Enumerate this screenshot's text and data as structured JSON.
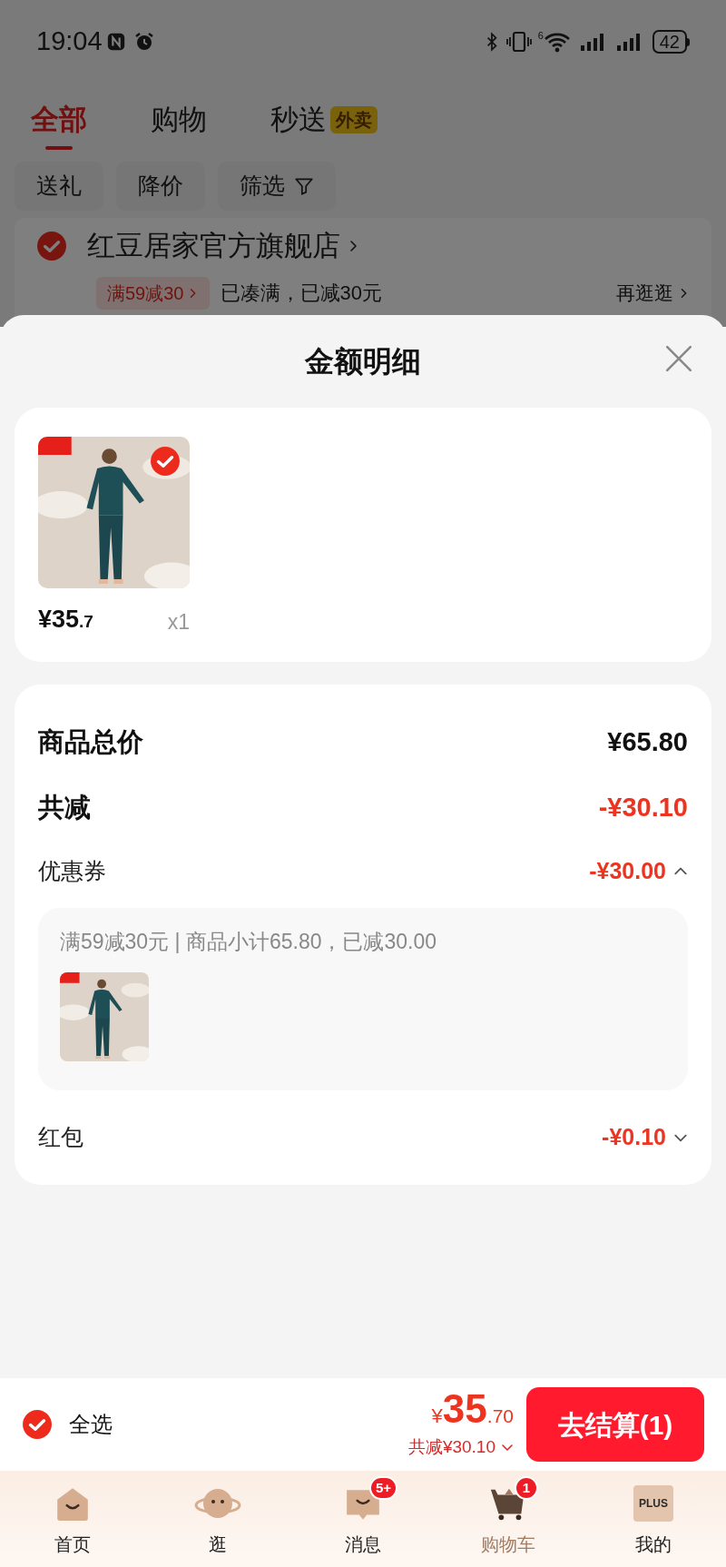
{
  "status_bar": {
    "time": "19:04",
    "wifi_label": "6",
    "battery": "42"
  },
  "tabs": [
    {
      "label": "全部",
      "selected": true
    },
    {
      "label": "购物",
      "selected": false
    },
    {
      "label": "秒送",
      "badge": "外卖",
      "selected": false
    }
  ],
  "filters": [
    {
      "label": "送礼",
      "kind": "plain"
    },
    {
      "label": "降价",
      "kind": "plain"
    },
    {
      "label": "筛选",
      "kind": "filter"
    }
  ],
  "store": {
    "name": "红豆居家官方旗舰店",
    "checked": true,
    "promo_tag": "满59减30",
    "promo_text": "已凑满，已减30元",
    "more_link": "再逛逛"
  },
  "sheet": {
    "title": "金额明细",
    "items": [
      {
        "kind": "picture",
        "price_integer": "¥35",
        "price_decimal": ".7",
        "quantity": "x1",
        "selected": true
      }
    ],
    "rows": [
      {
        "kind": "total",
        "label": "商品总价",
        "value": "¥65.80"
      },
      {
        "kind": "discount",
        "label": "共减",
        "value": "-¥30.10"
      },
      {
        "kind": "expandable",
        "label": "优惠券",
        "value": "-¥30.00",
        "expanded": true,
        "detail": "满59减30元 | 商品小计65.80，已减30.00"
      },
      {
        "kind": "expandable",
        "label": "红包",
        "value": "-¥0.10",
        "expanded": false
      }
    ]
  },
  "footer": {
    "select_all": {
      "label": "全选",
      "checked": true
    },
    "currency": "¥",
    "total_integer": "35",
    "total_decimal": ".70",
    "saved": "共减¥30.10",
    "checkout": "去结算(1)"
  },
  "nav": [
    {
      "label": "首页",
      "kind": "home",
      "selected": false
    },
    {
      "label": "逛",
      "kind": "planet",
      "selected": false
    },
    {
      "label": "消息",
      "kind": "message",
      "badge": "5+",
      "selected": false
    },
    {
      "label": "购物车",
      "kind": "cart",
      "badge": "1",
      "selected": true
    },
    {
      "label": "我的",
      "kind": "plus",
      "icon_text": "PLUS",
      "selected": false
    }
  ]
}
